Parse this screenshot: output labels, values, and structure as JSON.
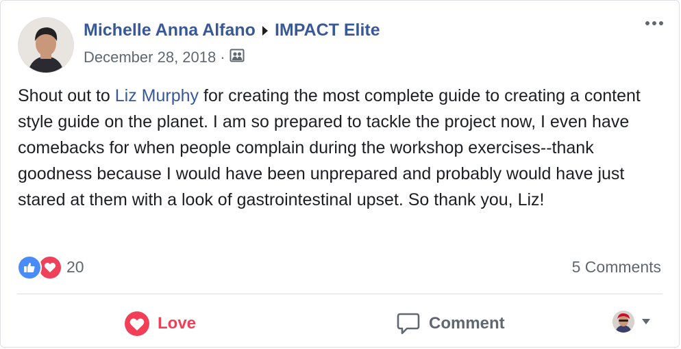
{
  "post": {
    "author": "Michelle Anna Alfano",
    "group": "IMPACT Elite",
    "date": "December 28, 2018",
    "separator": "·",
    "privacy_icon": "group-members-icon",
    "text_before": "Shout out to ",
    "mention": "Liz Murphy",
    "text_after": " for creating the most complete guide to creating a content style guide on the planet. I am so prepared to tackle the project now, I even have comebacks for when people complain during the workshop exercises--thank goodness because I would have been unprepared and probably would have just stared at them with a look of gastrointestinal upset. So thank you, Liz!"
  },
  "reactions": {
    "count": "20",
    "types": [
      "like",
      "love"
    ],
    "like_color": "#4a8cf7",
    "love_color": "#f0415a"
  },
  "comments": {
    "count_label": "5 Comments"
  },
  "actions": {
    "love_label": "Love",
    "comment_label": "Comment"
  },
  "colors": {
    "link": "#385898",
    "text": "#1c1e21",
    "secondary": "#606770",
    "love_active": "#f33e58"
  }
}
